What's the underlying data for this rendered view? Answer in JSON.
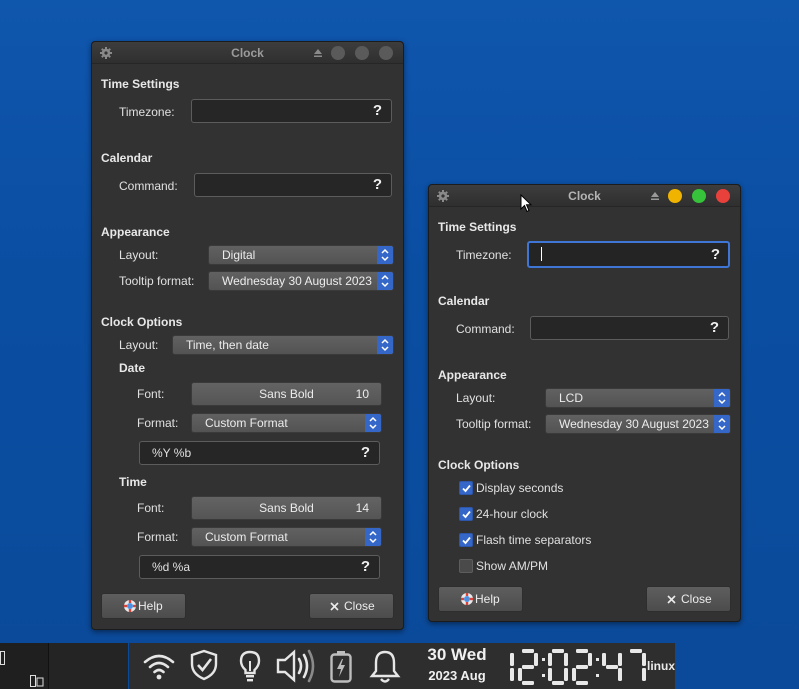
{
  "left_window": {
    "title": "Clock",
    "time_settings": {
      "heading": "Time Settings",
      "timezone_label": "Timezone:",
      "timezone_value": "",
      "help_glyph": "?"
    },
    "calendar": {
      "heading": "Calendar",
      "command_label": "Command:",
      "command_value": "",
      "help_glyph": "?"
    },
    "appearance": {
      "heading": "Appearance",
      "layout_label": "Layout:",
      "layout_value": "Digital",
      "tooltip_label": "Tooltip format:",
      "tooltip_value": "Wednesday 30 August 2023"
    },
    "clock_options": {
      "heading": "Clock Options",
      "layout_label": "Layout:",
      "layout_value": "Time, then date",
      "date": {
        "heading": "Date",
        "font_label": "Font:",
        "font_name": "Sans Bold",
        "font_size": "10",
        "format_label": "Format:",
        "format_value": "Custom Format",
        "custom_format": "%Y %b",
        "help_glyph": "?"
      },
      "time": {
        "heading": "Time",
        "font_label": "Font:",
        "font_name": "Sans Bold",
        "font_size": "14",
        "format_label": "Format:",
        "format_value": "Custom Format",
        "custom_format": "%d %a",
        "help_glyph": "?"
      }
    },
    "help_button": "Help",
    "close_button": "Close"
  },
  "right_window": {
    "title": "Clock",
    "time_settings": {
      "heading": "Time Settings",
      "timezone_label": "Timezone:",
      "timezone_value": "",
      "help_glyph": "?"
    },
    "calendar": {
      "heading": "Calendar",
      "command_label": "Command:",
      "command_value": "",
      "help_glyph": "?"
    },
    "appearance": {
      "heading": "Appearance",
      "layout_label": "Layout:",
      "layout_value": "LCD",
      "tooltip_label": "Tooltip format:",
      "tooltip_value": "Wednesday 30 August 2023"
    },
    "clock_options": {
      "heading": "Clock Options",
      "options": [
        {
          "label": "Display seconds",
          "checked": true
        },
        {
          "label": "24-hour clock",
          "checked": true
        },
        {
          "label": "Flash time separators",
          "checked": true
        },
        {
          "label": "Show AM/PM",
          "checked": false
        }
      ]
    },
    "help_button": "Help",
    "close_button": "Close",
    "window_button_colors": {
      "minimize": "#f0b400",
      "maximize": "#36c23a",
      "close": "#e8413c"
    }
  },
  "taskbar": {
    "date_line1": "30 Wed",
    "date_line2": "2023 Aug",
    "lcd_time": "12:02:47",
    "hostname": "linux",
    "tray_icons": [
      "wifi-icon",
      "shield-check-icon",
      "lightbulb-icon",
      "volume-icon",
      "battery-icon",
      "bell-icon"
    ]
  },
  "colors": {
    "desktop": "#0b50a6",
    "window_bg": "#323232",
    "accent": "#3567c9"
  }
}
